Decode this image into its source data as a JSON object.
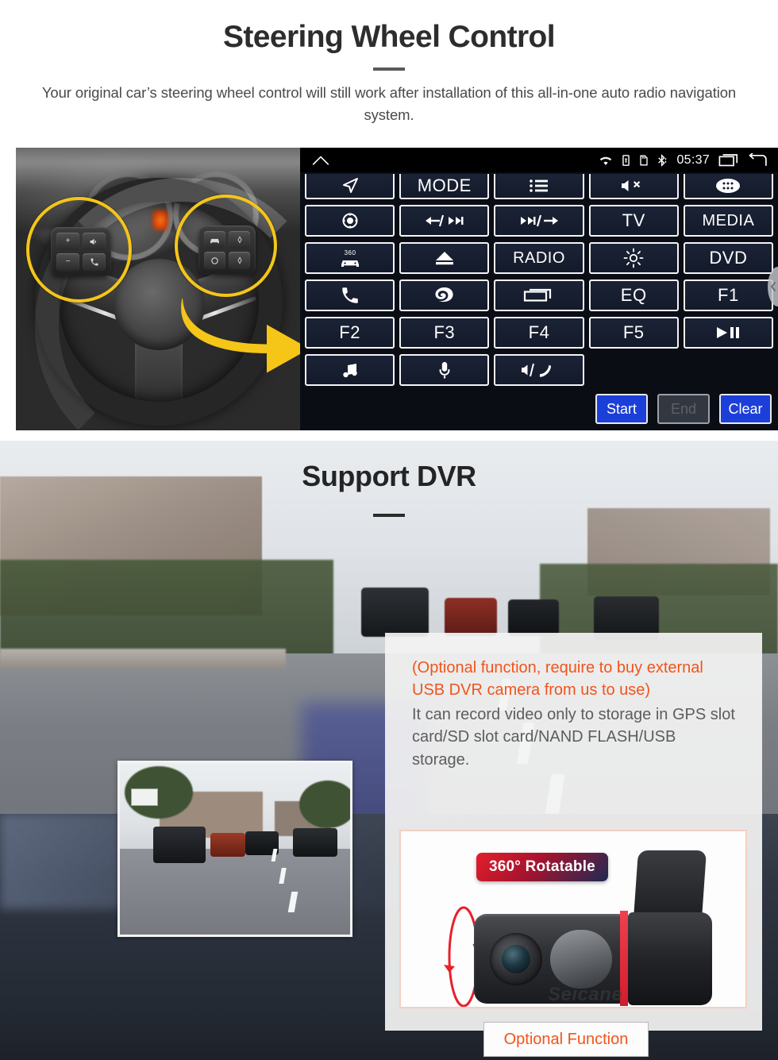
{
  "section_steering": {
    "title": "Steering Wheel Control",
    "subtitle": "Your original car’s steering wheel control will still work after installation of this all-in-one auto radio navigation system.",
    "head_unit": {
      "status_bar": {
        "home_icon": "home-icon",
        "wifi_icon": "wifi-icon",
        "battery_icon": "battery-lock-icon",
        "sdcard_icon": "sd-card-icon",
        "bluetooth_icon": "bluetooth-icon",
        "time": "05:37",
        "recents_icon": "recent-apps-icon",
        "back_icon": "back-icon"
      },
      "buttons": [
        {
          "label": "",
          "icon": "navigation-arrow-icon"
        },
        {
          "label": "MODE",
          "icon": ""
        },
        {
          "label": "",
          "icon": "list-menu-icon"
        },
        {
          "label": "",
          "icon": "mute-icon"
        },
        {
          "label": "",
          "icon": "app-drawer-icon"
        },
        {
          "label": "",
          "icon": "target-power-icon"
        },
        {
          "label": "",
          "icon": "previous-track-icon"
        },
        {
          "label": "",
          "icon": "next-track-icon"
        },
        {
          "label": "TV",
          "icon": ""
        },
        {
          "label": "MEDIA",
          "icon": ""
        },
        {
          "label": "",
          "icon": "360-camera-icon"
        },
        {
          "label": "",
          "icon": "eject-icon"
        },
        {
          "label": "RADIO",
          "icon": ""
        },
        {
          "label": "",
          "icon": "brightness-icon"
        },
        {
          "label": "DVD",
          "icon": ""
        },
        {
          "label": "",
          "icon": "phone-icon"
        },
        {
          "label": "",
          "icon": "swirl-icon"
        },
        {
          "label": "",
          "icon": "display-window-icon"
        },
        {
          "label": "EQ",
          "icon": ""
        },
        {
          "label": "F1",
          "icon": ""
        },
        {
          "label": "F2",
          "icon": ""
        },
        {
          "label": "F3",
          "icon": ""
        },
        {
          "label": "F4",
          "icon": ""
        },
        {
          "label": "F5",
          "icon": ""
        },
        {
          "label": "",
          "icon": "play-pause-icon"
        },
        {
          "label": "",
          "icon": "music-note-icon"
        },
        {
          "label": "",
          "icon": "microphone-icon"
        },
        {
          "label": "",
          "icon": "volume-hangup-icon"
        }
      ],
      "actions": {
        "start": "Start",
        "end": "End",
        "clear": "Clear"
      },
      "scroll_handle_icon": "chevron-left-icon"
    },
    "photo": {
      "left_cluster_keys": [
        "+",
        "−",
        "mute-voice-icon",
        "call-icon"
      ],
      "right_cluster_keys": [
        "cruise-icon",
        "diamond-up-icon",
        "circle-icon",
        "diamond-down-icon"
      ],
      "highlight_color": "#f5c518",
      "arrow_color": "#f5c518"
    }
  },
  "section_dvr": {
    "title": "Support DVR",
    "card": {
      "note_orange": "(Optional function, require to buy external USB DVR camera from us to use)",
      "note_gray": "It can record video only to storage in GPS slot card/SD slot card/NAND FLASH/USB storage.",
      "badge": "360° Rotatable",
      "watermark": "Seicane",
      "optional_button": "Optional Function",
      "orange_hex": "#f2541b",
      "badge_gradient": [
        "#e31f2b",
        "#1e2a55"
      ]
    }
  }
}
